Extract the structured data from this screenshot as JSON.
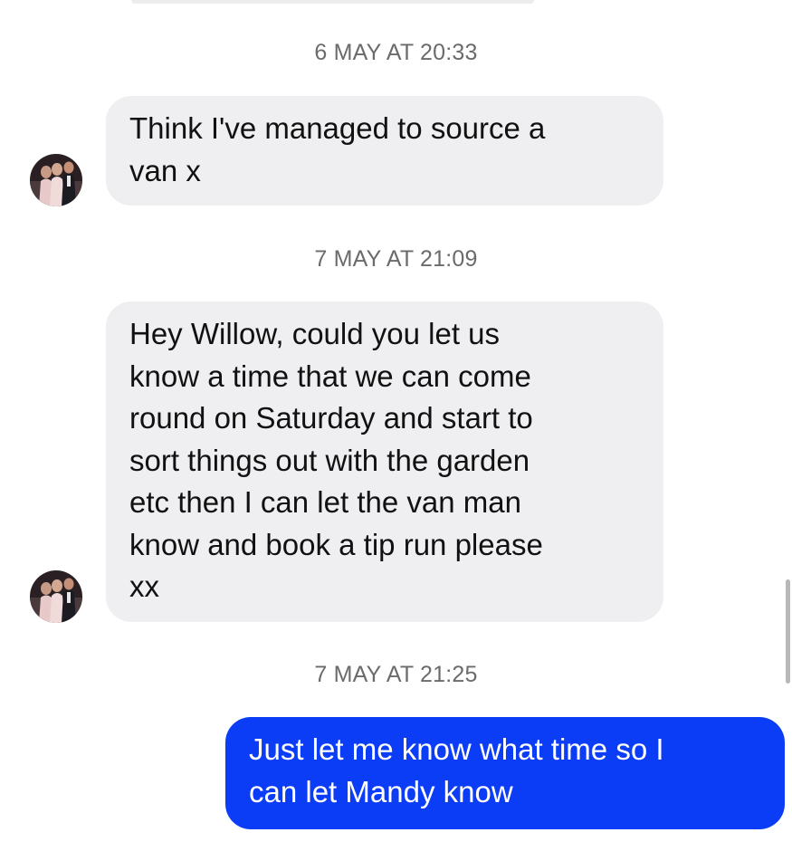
{
  "conversation": {
    "messages": [
      {
        "timestamp": "6 MAY AT 20:33",
        "direction": "incoming",
        "text": "Think I've managed to source a\nvan x"
      },
      {
        "timestamp": "7 MAY AT 21:09",
        "direction": "incoming",
        "text": "Hey Willow, could you let us\nknow a time that we can come\nround on Saturday and start to\nsort things out with the garden\netc then I can let the van man\nknow and book a tip run please\nxx"
      },
      {
        "timestamp": "7 MAY AT 21:25",
        "direction": "outgoing",
        "text": "Just let me know what time so I\ncan let Mandy know"
      }
    ]
  },
  "colors": {
    "incoming_bubble": "#efeff1",
    "outgoing_bubble": "#0b3df7",
    "timestamp_text": "#6b6b6b"
  }
}
